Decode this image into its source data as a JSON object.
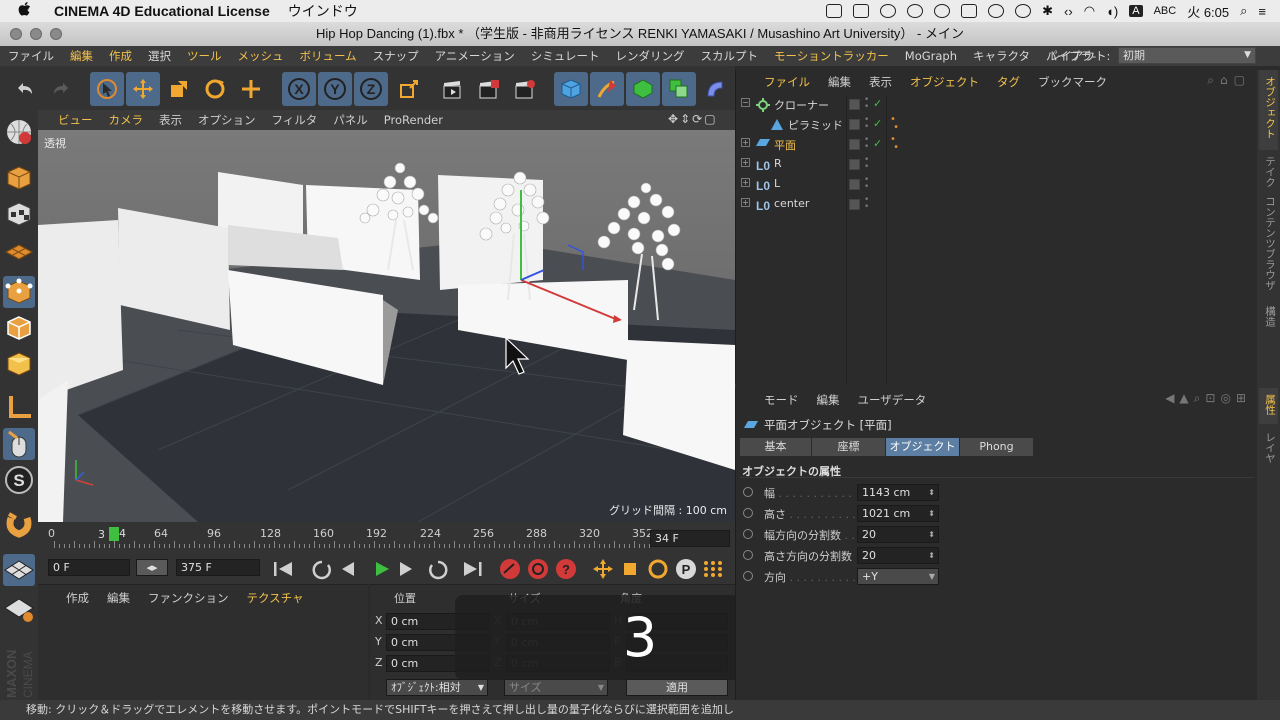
{
  "macbar": {
    "apple": "",
    "app_name": "CINEMA 4D Educational License",
    "window_menu": "ウインドウ",
    "input_badge": "A",
    "input_label": "ABC",
    "clock": "火 6:05"
  },
  "window": {
    "title": "Hip Hop Dancing (1).fbx * （学生版 - 非商用ライセンス RENKI YAMASAKI / Musashino Art University） - メイン"
  },
  "menu": {
    "items": [
      {
        "label": "ファイル",
        "hl": false
      },
      {
        "label": "編集",
        "hl": true
      },
      {
        "label": "作成",
        "hl": true
      },
      {
        "label": "選択",
        "hl": false
      },
      {
        "label": "ツール",
        "hl": true
      },
      {
        "label": "メッシュ",
        "hl": true
      },
      {
        "label": "ボリューム",
        "hl": true
      },
      {
        "label": "スナップ",
        "hl": false
      },
      {
        "label": "アニメーション",
        "hl": false
      },
      {
        "label": "シミュレート",
        "hl": false
      },
      {
        "label": "レンダリング",
        "hl": false
      },
      {
        "label": "スカルプト",
        "hl": false
      },
      {
        "label": "モーショントラッカー",
        "hl": true
      },
      {
        "label": "MoGraph",
        "hl": false
      },
      {
        "label": "キャラクタ",
        "hl": false
      },
      {
        "label": "パイプラ-",
        "hl": false
      }
    ],
    "layout_label": "レイアウト:",
    "layout_value": "初期"
  },
  "viewport": {
    "menu": [
      {
        "label": "ビュー",
        "hl": true
      },
      {
        "label": "カメラ",
        "hl": true
      },
      {
        "label": "表示",
        "hl": false
      },
      {
        "label": "オプション",
        "hl": false
      },
      {
        "label": "フィルタ",
        "hl": false
      },
      {
        "label": "パネル",
        "hl": false
      },
      {
        "label": "ProRender",
        "hl": false
      }
    ],
    "view_name": "透視",
    "grid_info": "グリッド間隔 : 100 cm"
  },
  "timeline": {
    "ticks": [
      "0",
      "34",
      "64",
      "96",
      "128",
      "160",
      "192",
      "224",
      "256",
      "288",
      "320",
      "352"
    ],
    "current_frame_marker": "3",
    "frame_field": "34 F",
    "playhead_fraction": 0.094
  },
  "controls": {
    "start_frame": "0 F",
    "end_frame": "375 F"
  },
  "material_panel": {
    "menu": [
      {
        "label": "作成",
        "hl": false
      },
      {
        "label": "編集",
        "hl": false
      },
      {
        "label": "ファンクション",
        "hl": false
      },
      {
        "label": "テクスチャ",
        "hl": true
      }
    ]
  },
  "coords": {
    "headers": [
      "位置",
      "サイズ",
      "角度"
    ],
    "rows": [
      {
        "axis": "X",
        "pos": "0 cm",
        "size_axis": "X",
        "size": "0 cm",
        "rot_axis": "H",
        "rot": ""
      },
      {
        "axis": "Y",
        "pos": "0 cm",
        "size_axis": "Y",
        "size": "0 cm",
        "rot_axis": "P",
        "rot": ""
      },
      {
        "axis": "Z",
        "pos": "0 cm",
        "size_axis": "Z",
        "size": "0 cm",
        "rot_axis": "B",
        "rot": ""
      }
    ],
    "mode_select": "ｵﾌﾞｼﾞｪｸﾄ:相対",
    "size_select": "サイズ",
    "apply_button": "適用"
  },
  "overlay": {
    "countdown": "3"
  },
  "object_manager": {
    "menu": [
      {
        "label": "ファイル",
        "hl": true
      },
      {
        "label": "編集",
        "hl": false
      },
      {
        "label": "表示",
        "hl": false
      },
      {
        "label": "オブジェクト",
        "hl": true
      },
      {
        "label": "タグ",
        "hl": true
      },
      {
        "label": "ブックマーク",
        "hl": false
      }
    ],
    "objects": [
      {
        "name": "クローナー",
        "indent": 0,
        "selected": false,
        "icon": "cloner-icon",
        "tags": false,
        "check": true
      },
      {
        "name": "ピラミッド",
        "indent": 1,
        "selected": false,
        "icon": "pyramid-icon",
        "tags": true,
        "check": true
      },
      {
        "name": "平面",
        "indent": 0,
        "selected": true,
        "icon": "plane-icon",
        "tags": true,
        "check": true
      },
      {
        "name": "R",
        "indent": 0,
        "selected": false,
        "icon": "null-icon",
        "tags": false,
        "check": false
      },
      {
        "name": "L",
        "indent": 0,
        "selected": false,
        "icon": "null-icon",
        "tags": false,
        "check": false
      },
      {
        "name": "center",
        "indent": 0,
        "selected": false,
        "icon": "null-icon",
        "tags": false,
        "check": false
      }
    ]
  },
  "attributes": {
    "menu": [
      {
        "label": "モード",
        "hl": false
      },
      {
        "label": "編集",
        "hl": false
      },
      {
        "label": "ユーザデータ",
        "hl": false
      }
    ],
    "object_title": "平面オブジェクト [平面]",
    "tabs": [
      {
        "label": "基本",
        "active": false
      },
      {
        "label": "座標",
        "active": false
      },
      {
        "label": "オブジェクト",
        "active": true
      },
      {
        "label": "Phong",
        "active": false
      }
    ],
    "section_title": "オブジェクトの属性",
    "props": [
      {
        "label": "幅",
        "value": "1143 cm"
      },
      {
        "label": "高さ",
        "value": "1021 cm"
      },
      {
        "label": "幅方向の分割数",
        "value": "20"
      },
      {
        "label": "高さ方向の分割数",
        "value": "20"
      },
      {
        "label": "方向",
        "value": "+Y"
      }
    ]
  },
  "right_tabs": [
    {
      "label": "オブジェクト",
      "hl": true
    },
    {
      "label": "テイク",
      "hl": false
    },
    {
      "label": "コンテンツブラウザ",
      "hl": false
    },
    {
      "label": "構造",
      "hl": false
    },
    {
      "label": "属性",
      "hl": true
    },
    {
      "label": "レイヤ",
      "hl": false
    }
  ],
  "status": {
    "text": "移動: クリック＆ドラッグでエレメントを移動させます。ポイントモードでSHIFTキーを押さえて押し出し量の量子化ならびに選択範囲を追加し"
  },
  "colors": {
    "accent": "#f2c14b",
    "selection": "#5d7fa3",
    "play_green": "#3fbf3f",
    "record_red": "#d23a3a"
  }
}
